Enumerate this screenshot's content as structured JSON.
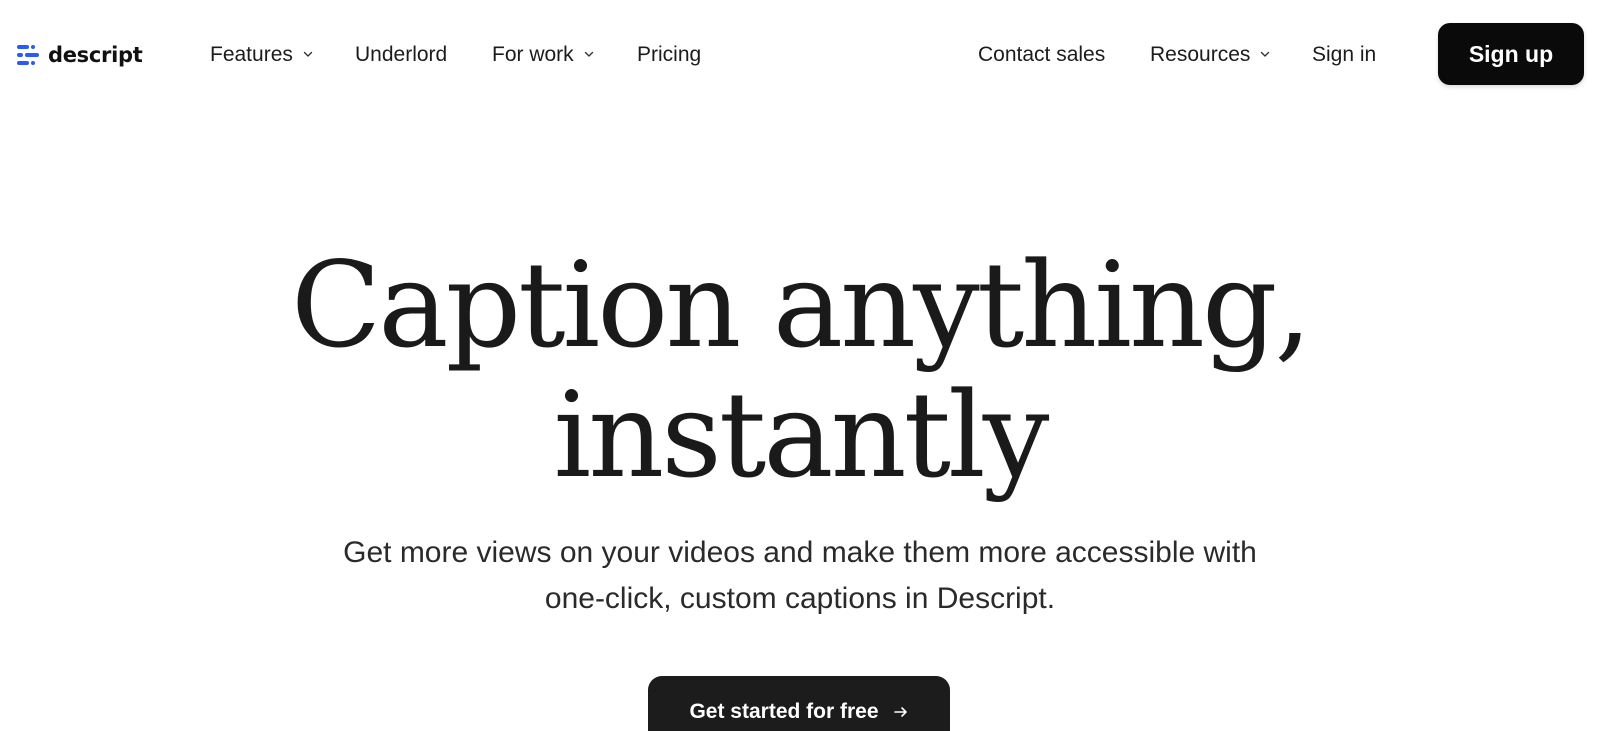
{
  "brand": {
    "name": "descript",
    "accent_color": "#2b5bf5"
  },
  "nav": {
    "left_items": [
      {
        "label": "Features",
        "has_dropdown": true
      },
      {
        "label": "Underlord",
        "has_dropdown": false
      },
      {
        "label": "For work",
        "has_dropdown": true
      },
      {
        "label": "Pricing",
        "has_dropdown": false
      }
    ],
    "right_items": [
      {
        "label": "Contact sales",
        "has_dropdown": false
      },
      {
        "label": "Resources",
        "has_dropdown": true
      },
      {
        "label": "Sign in",
        "has_dropdown": false
      }
    ],
    "signup_label": "Sign up"
  },
  "hero": {
    "title_line1": "Caption anything,",
    "title_line2": "instantly",
    "subtitle_line1": "Get more views on your videos and make them more accessible with",
    "subtitle_line2": "one-click, custom captions in Descript.",
    "cta_label": "Get started for free"
  }
}
